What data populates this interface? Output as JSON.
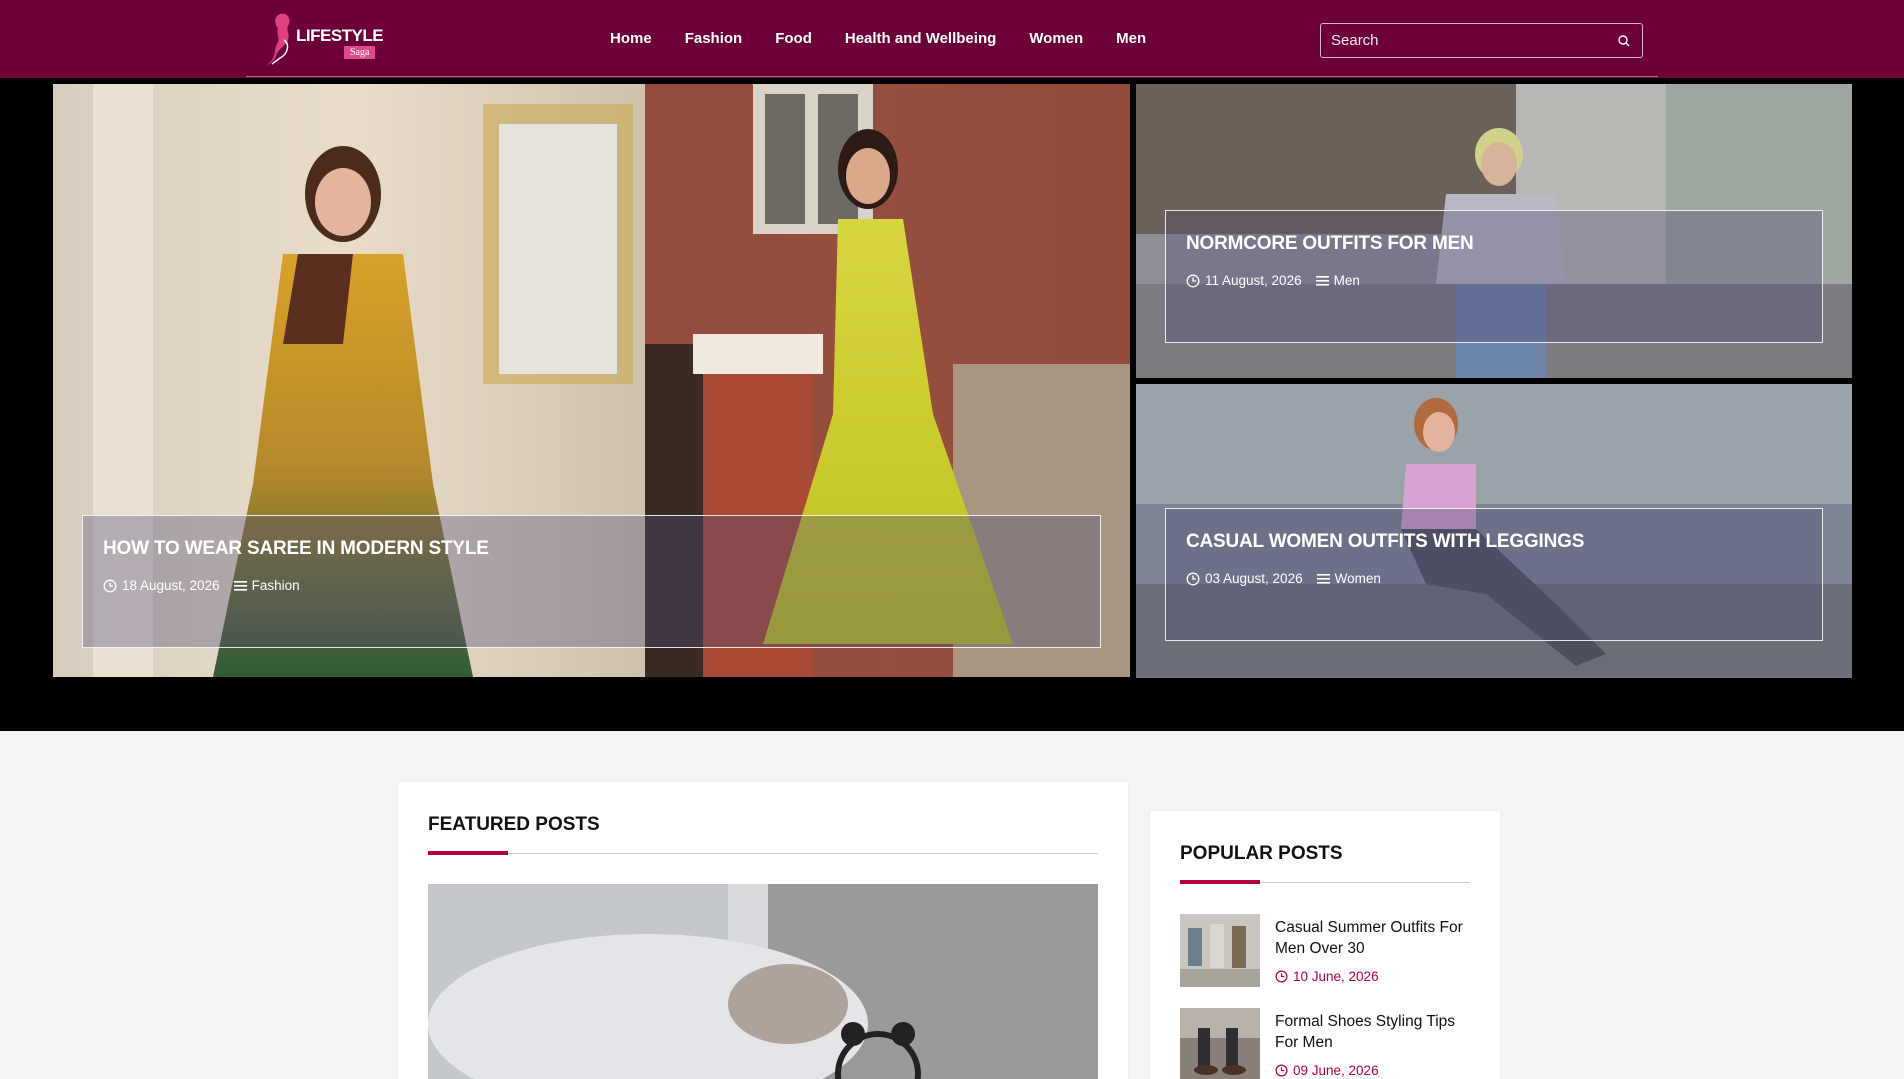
{
  "header": {
    "logo": {
      "main": "LIFESTYLE",
      "tag": "Saga"
    },
    "nav": [
      "Home",
      "Fashion",
      "Food",
      "Health and Wellbeing",
      "Women",
      "Men"
    ],
    "search": {
      "placeholder": "Search",
      "value": ""
    }
  },
  "hero": [
    {
      "title": "HOW TO WEAR SAREE IN MODERN STYLE",
      "date": "18 August, 2026",
      "category": "Fashion"
    },
    {
      "title": "NORMCORE OUTFITS FOR MEN",
      "date": "11 August, 2026",
      "category": "Men"
    },
    {
      "title": "CASUAL WOMEN OUTFITS WITH LEGGINGS",
      "date": "03 August, 2026",
      "category": "Women"
    }
  ],
  "featured": {
    "title": "FEATURED POSTS"
  },
  "popular": {
    "title": "POPULAR POSTS",
    "items": [
      {
        "title": "Casual Summer Outfits For Men Over 30",
        "date": "10 June, 2026"
      },
      {
        "title": "Formal Shoes Styling Tips For Men",
        "date": "09 June, 2026"
      }
    ]
  },
  "colors": {
    "header": "#6d0039",
    "accent": "#b2003e",
    "background": "#f5f5f5"
  },
  "icons": {
    "search": "search-icon",
    "date": "clock-icon",
    "category": "list-icon"
  }
}
